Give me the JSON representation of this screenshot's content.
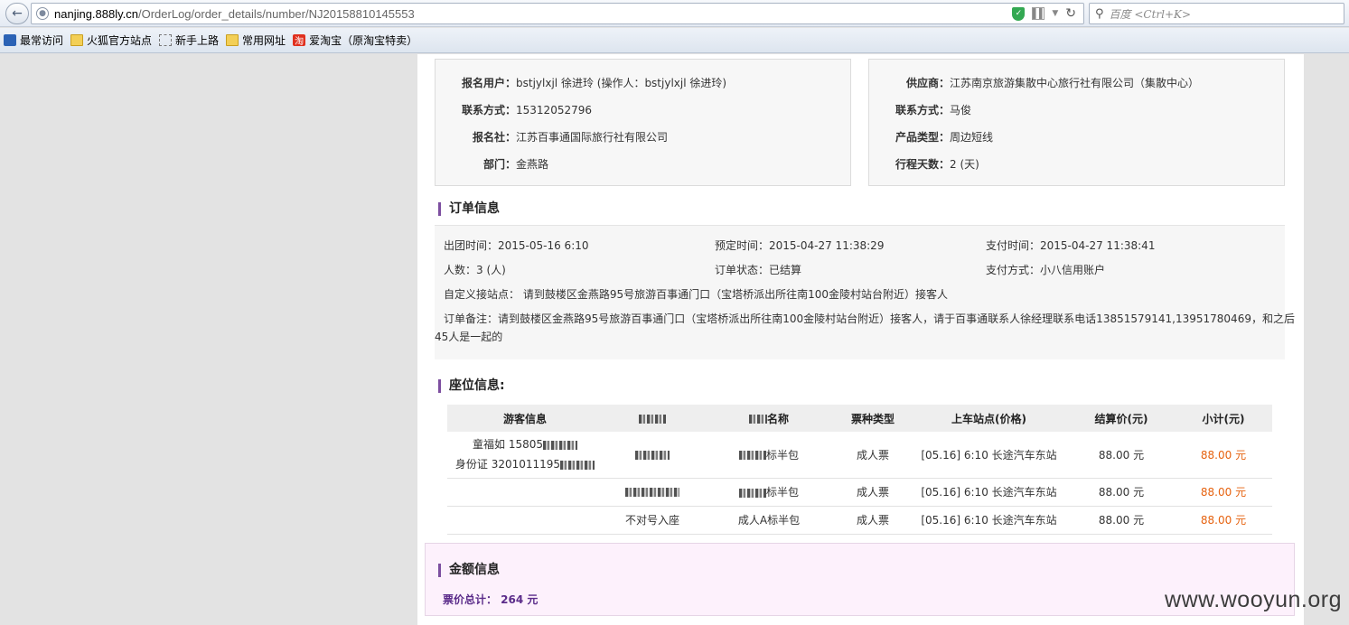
{
  "browser": {
    "url_domain": "nanjing.888ly.cn",
    "url_path": "/OrderLog/order_details/number/NJ20158810145553",
    "search_placeholder": "百度 <Ctrl+K>",
    "bookmarks": [
      "最常访问",
      "火狐官方站点",
      "新手上路",
      "常用网址",
      "爱淘宝（原淘宝特卖）"
    ],
    "taobao_glyph": "淘"
  },
  "left_card": {
    "rows": [
      {
        "k": "报名用户：",
        "v": "bstjylxjl 徐进玲 (操作人：bstjylxjl 徐进玲)"
      },
      {
        "k": "联系方式：",
        "v": "15312052796"
      },
      {
        "k": "报名社：",
        "v": "江苏百事通国际旅行社有限公司"
      },
      {
        "k": "部门：",
        "v": "金燕路"
      }
    ]
  },
  "right_card": {
    "rows": [
      {
        "k": "供应商：",
        "v": "江苏南京旅游集散中心旅行社有限公司（集散中心）"
      },
      {
        "k": "联系方式：",
        "v": "马俊"
      },
      {
        "k": "产品类型：",
        "v": "周边短线"
      },
      {
        "k": "行程天数：",
        "v": "2 (天)"
      }
    ]
  },
  "order_info": {
    "title": "订单信息",
    "depart_time": "出团时间：2015-05-16 6:10",
    "book_time": "预定时间：2015-04-27 11:38:29",
    "pay_time": "支付时间：2015-04-27 11:38:41",
    "people": "人数：3 (人)",
    "status": "订单状态：已结算",
    "pay_method": "支付方式：小八信用账户",
    "pickup": "自定义接站点： 请到鼓楼区金燕路95号旅游百事通门口（宝塔桥派出所往南100金陵村站台附近）接客人",
    "remark_line1": "订单备注：请到鼓楼区金燕路95号旅游百事通门口（宝塔桥派出所往南100金陵村站台附近）接客人，请于百事通联系人徐经理联系电话13851579141,13951780469，和之后",
    "remark_line2": "45人是一起的"
  },
  "seat_info": {
    "title": "座位信息:",
    "headers": {
      "guest": "游客信息",
      "seat": "",
      "name": "名称",
      "ticket_type": "票种类型",
      "station": "上车站点(价格)",
      "settle": "结算价(元)",
      "subtotal": "小计(元)"
    },
    "guest_name": "童福如 15805",
    "guest_id": "身份证 3201011195",
    "rows": [
      {
        "seat": "",
        "name": "标半包",
        "ticket": "成人票",
        "station": "[05.16] 6:10 长途汽车东站",
        "settle": "88.00 元",
        "subtotal": "88.00 元"
      },
      {
        "seat": "",
        "name": "标半包",
        "ticket": "成人票",
        "station": "[05.16] 6:10 长途汽车东站",
        "settle": "88.00 元",
        "subtotal": "88.00 元"
      },
      {
        "seat": "不对号入座",
        "name": "成人A标半包",
        "ticket": "成人票",
        "station": "[05.16] 6:10 长途汽车东站",
        "settle": "88.00 元",
        "subtotal": "88.00 元"
      }
    ]
  },
  "amount_info": {
    "title": "金额信息",
    "total": "票价总计： 264 元"
  },
  "watermark": "www.wooyun.org",
  "colors": {
    "accent_bar": "#7d4fa0",
    "price_red": "#e6620f",
    "amount_bg": "#fdf1fc"
  }
}
